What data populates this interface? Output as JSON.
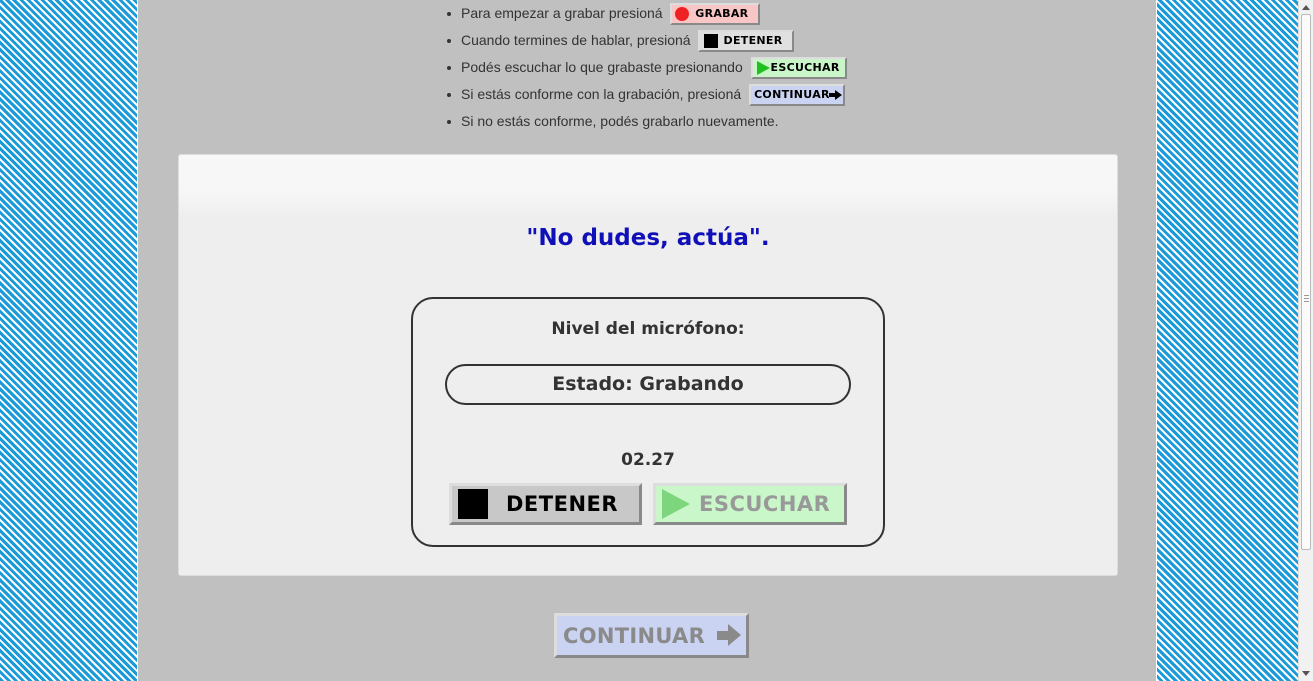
{
  "instructions": [
    {
      "text": "Para empezar a grabar presioná",
      "button_label": "GRABAR",
      "icon": "record-dot-icon",
      "button_color": "#f9c6c6"
    },
    {
      "text": "Cuando termines de hablar, presioná",
      "button_label": "DETENER",
      "icon": "stop-square-icon",
      "button_color": "#e0e0e0"
    },
    {
      "text": "Podés escuchar lo que grabaste presionando",
      "button_label": "ESCUCHAR",
      "icon": "play-triangle-icon",
      "button_color": "#c9f5c9"
    },
    {
      "text": "Si estás conforme con la grabación, presioná",
      "button_label": "CONTINUAR",
      "icon": "arrow-right-icon",
      "button_color": "#cad3f2"
    },
    {
      "text": "Si no estás conforme, podés grabarlo nuevamente."
    }
  ],
  "panel": {
    "phrase": "\"No dudes, actúa\".",
    "mic_label": "Nivel del micrófono:",
    "status": "Estado: Grabando",
    "timer": "02.27",
    "stop_label": "DETENER",
    "listen_label": "ESCUCHAR"
  },
  "continue_label": "CONTINUAR",
  "colors": {
    "phrase": "#1010b8",
    "page_bg": "#c0c0c0",
    "stripe": "#1a9ad9"
  }
}
